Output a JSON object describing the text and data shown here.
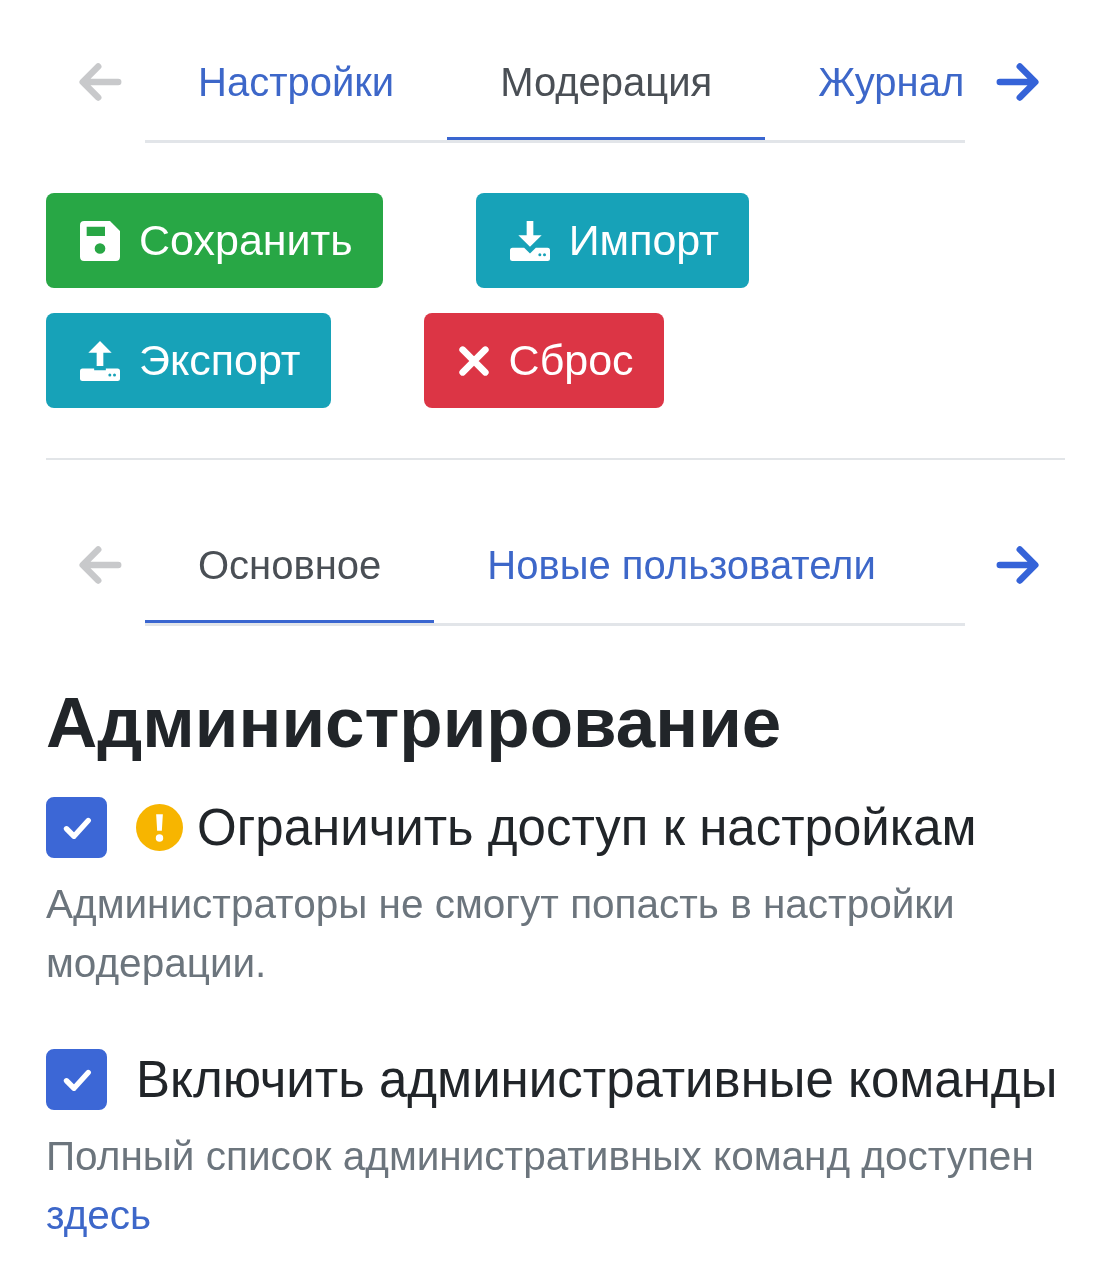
{
  "top_tabs": {
    "prev_arrow": {
      "disabled": true
    },
    "next_arrow": {
      "disabled": false
    },
    "tabs": [
      {
        "label": "Настройки",
        "selected": false
      },
      {
        "label": "Модерация",
        "selected": true
      },
      {
        "label": "Журнал",
        "selected": false
      }
    ]
  },
  "toolbar": {
    "buttons": [
      {
        "label": "Сохранить",
        "kind": "save"
      },
      {
        "label": "Импорт",
        "kind": "import"
      },
      {
        "label": "Экспорт",
        "kind": "export"
      },
      {
        "label": "Сброс",
        "kind": "reset"
      }
    ]
  },
  "section_tabs": {
    "prev_arrow": {
      "disabled": true
    },
    "next_arrow": {
      "disabled": false
    },
    "tabs": [
      {
        "label": "Основное",
        "selected": true
      },
      {
        "label": "Новые пользователи",
        "selected": false
      }
    ]
  },
  "section": {
    "title": "Администрирование",
    "settings": [
      {
        "label": "Ограничить доступ к настройкам",
        "checked": true,
        "warning": true,
        "description": "Администраторы не смогут попасть в настройки модерации."
      },
      {
        "label": "Включить административные команды",
        "checked": true,
        "warning": false,
        "description": "Полный список административных команд доступен",
        "link": "здесь"
      }
    ]
  }
}
